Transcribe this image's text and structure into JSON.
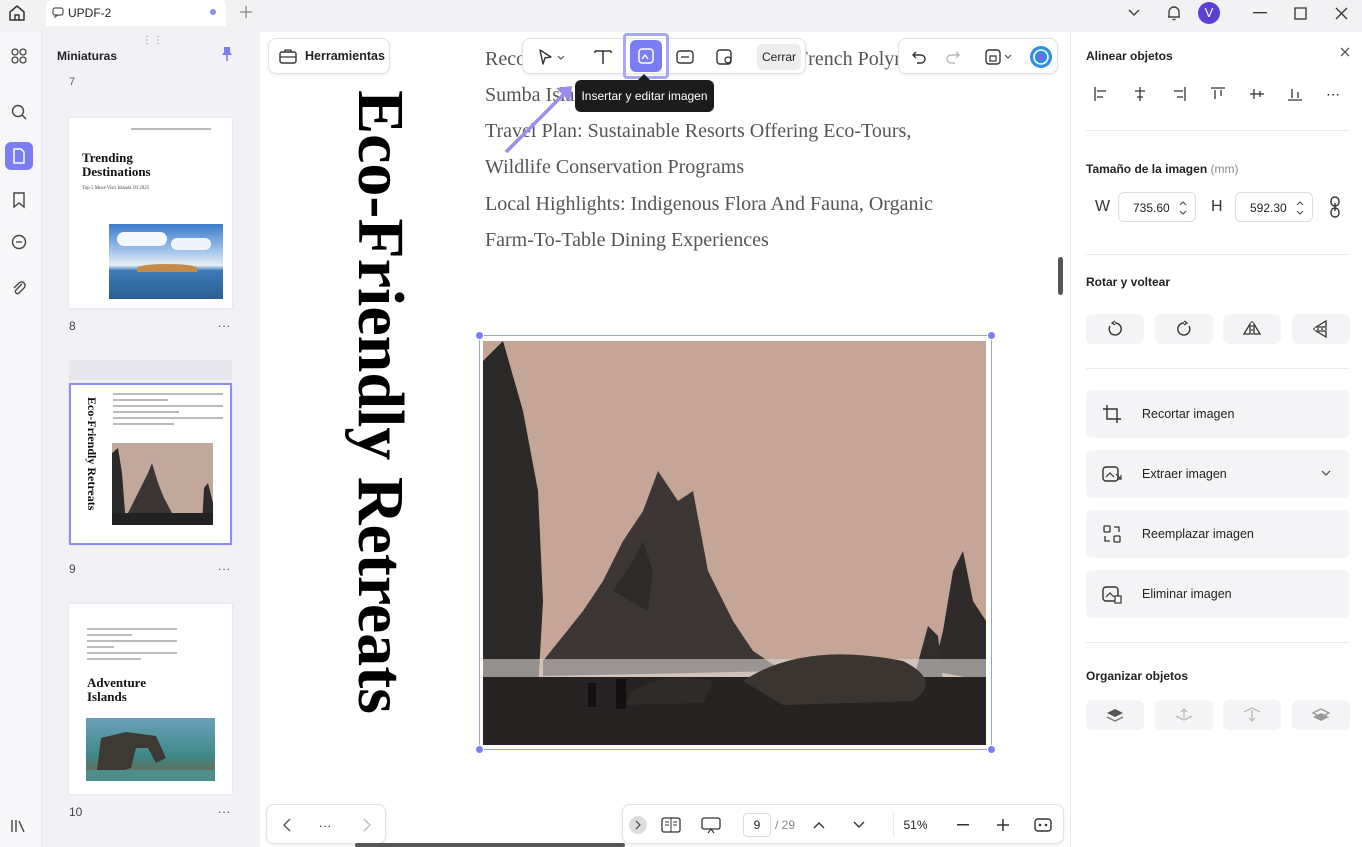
{
  "tab": {
    "title": "UPDF-2"
  },
  "user": {
    "avatar_initial": "V"
  },
  "thumbnails": {
    "title": "Miniaturas",
    "prev_page_num": "7",
    "pages": [
      {
        "num": "8",
        "title": "Trending Destinations",
        "subtitle": "Top 5 Must-Visit Islands Of 2025"
      },
      {
        "num": "9",
        "title": "Eco-Friendly Retreats"
      },
      {
        "num": "10",
        "title": "Adventure Islands"
      }
    ],
    "more": "..."
  },
  "toolbar": {
    "tools_label": "Herramientas",
    "close_label": "Cerrar",
    "tooltip": "Insertar y editar imagen"
  },
  "document": {
    "vertical_title": "Eco-Friendly Retreats",
    "lines": [
      "Recommended Destinations: Tetiaroa (French Polynesia),",
      "Sumba Island (Indonesia)",
      "Travel Plan: Sustainable Resorts Offering Eco-Tours,",
      "Wildlife Conservation Programs",
      "Local Highlights: Indigenous Flora And Fauna, Organic",
      "Farm-To-Table Dining Experiences"
    ]
  },
  "navigation": {
    "more": "...",
    "current_page": "9",
    "total_pages": "/ 29",
    "zoom": "51%"
  },
  "panel": {
    "align_title": "Alinear objetos",
    "size_title": "Tamaño de la imagen",
    "size_unit": "(mm)",
    "w_label": "W",
    "w_value": "735.60",
    "h_label": "H",
    "h_value": "592.30",
    "rotate_title": "Rotar y voltear",
    "actions": [
      "Recortar imagen",
      "Extraer imagen",
      "Reemplazar imagen",
      "Eliminar imagen"
    ],
    "organize_title": "Organizar objetos"
  },
  "colors": {
    "accent": "#7b7ef3",
    "accent_light": "#a6a8f6"
  }
}
